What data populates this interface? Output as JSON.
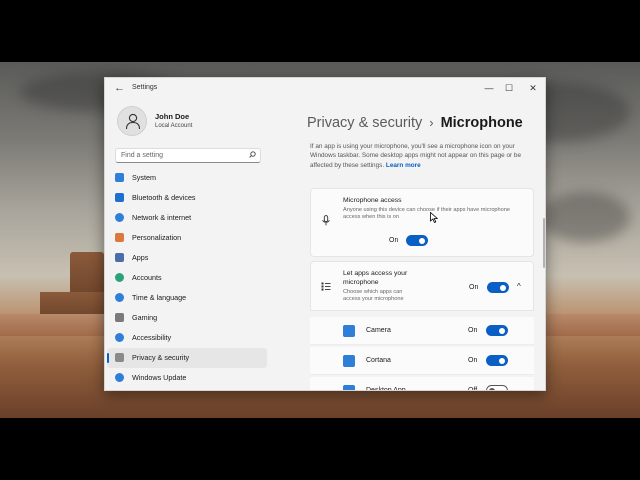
{
  "window": {
    "title": "Settings",
    "back_glyph": "←",
    "minimize_glyph": "—",
    "maximize_glyph": "☐",
    "close_glyph": "✕"
  },
  "profile": {
    "name": "John Doe",
    "account": "Local Account"
  },
  "search": {
    "placeholder": "Find a setting",
    "icon": "search-icon"
  },
  "sidebar": {
    "items": [
      {
        "label": "System",
        "icon": "monitor-icon",
        "color": "#2f7fd8",
        "selected": false
      },
      {
        "label": "Bluetooth & devices",
        "icon": "bluetooth-icon",
        "color": "#1f6fd0",
        "selected": false
      },
      {
        "label": "Network & internet",
        "icon": "wifi-icon",
        "color": "#2f7fd8",
        "selected": false
      },
      {
        "label": "Personalization",
        "icon": "brush-icon",
        "color": "#d97a3a",
        "selected": false
      },
      {
        "label": "Apps",
        "icon": "apps-icon",
        "color": "#4a6fa8",
        "selected": false
      },
      {
        "label": "Accounts",
        "icon": "person-icon",
        "color": "#2aa37a",
        "selected": false
      },
      {
        "label": "Time & language",
        "icon": "globe-clock-icon",
        "color": "#2f7fd8",
        "selected": false
      },
      {
        "label": "Gaming",
        "icon": "controller-icon",
        "color": "#7a7a7a",
        "selected": false
      },
      {
        "label": "Accessibility",
        "icon": "accessibility-icon",
        "color": "#2f7fd8",
        "selected": false
      },
      {
        "label": "Privacy & security",
        "icon": "shield-icon",
        "color": "#8a8a8a",
        "selected": true
      },
      {
        "label": "Windows Update",
        "icon": "update-icon",
        "color": "#2f7fd8",
        "selected": false
      }
    ]
  },
  "header": {
    "crumb": "Privacy & security",
    "separator": "›",
    "current": "Microphone"
  },
  "description": {
    "text": "If an app is using your microphone, you'll see a microphone icon on your Windows taskbar. Some desktop apps might not appear on this page or be affected by these settings.",
    "link": "Learn more"
  },
  "microphone_access": {
    "title": "Microphone access",
    "desc": "Anyone using this device can choose if their apps have microphone access when this is on",
    "state": "On",
    "on": true
  },
  "let_apps": {
    "title": "Let apps access your microphone",
    "desc": "Choose which apps can access your microphone",
    "state": "On",
    "on": true,
    "chevron": "^"
  },
  "apps": [
    {
      "name": "Camera",
      "state": "On",
      "on": true,
      "color": "#2f7fd8"
    },
    {
      "name": "Cortana",
      "state": "On",
      "on": true,
      "color": "#2f7fd8"
    },
    {
      "name": "Desktop App",
      "state": "Off",
      "on": false,
      "color": "#2f7fd8"
    }
  ],
  "accent_color": "#0a5fc4"
}
